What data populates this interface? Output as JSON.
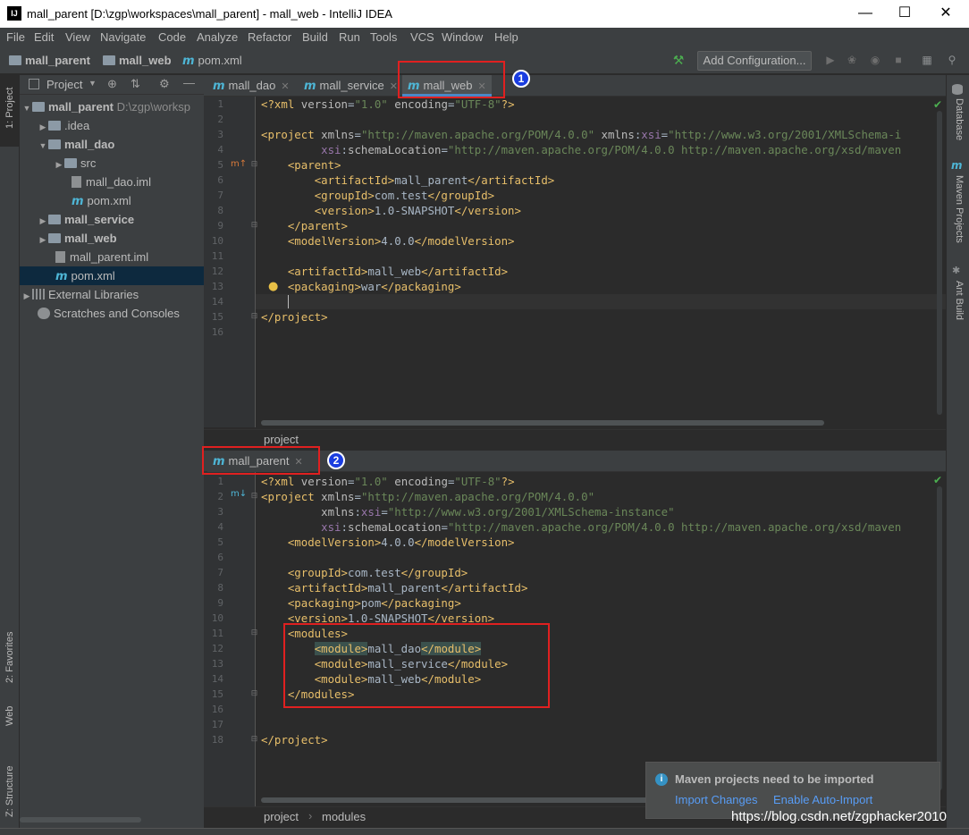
{
  "window": {
    "title": "mall_parent [D:\\zgp\\workspaces\\mall_parent] - mall_web - IntelliJ IDEA",
    "app_icon": "IJ"
  },
  "menu": [
    "File",
    "Edit",
    "View",
    "Navigate",
    "Code",
    "Analyze",
    "Refactor",
    "Build",
    "Run",
    "Tools",
    "VCS",
    "Window",
    "Help"
  ],
  "breadcrumb": {
    "root": "mall_parent",
    "module": "mall_web",
    "file": "pom.xml"
  },
  "toolbar": {
    "add_configuration": "Add Configuration..."
  },
  "left_strip": {
    "project": "1: Project",
    "favorites": "2: Favorites",
    "web": "Web",
    "structure": "Z: Structure"
  },
  "right_strip": {
    "database": "Database",
    "maven": "Maven Projects",
    "ant": "Ant Build"
  },
  "project_panel": {
    "header": "Project",
    "root_name": "mall_parent",
    "root_path": "D:\\zgp\\worksp",
    "idea": ".idea",
    "mall_dao": "mall_dao",
    "src": "src",
    "mall_dao_iml": "mall_dao.iml",
    "dao_pom": "pom.xml",
    "mall_service": "mall_service",
    "mall_web": "mall_web",
    "mall_parent_iml": "mall_parent.iml",
    "root_pom": "pom.xml",
    "external_libraries": "External Libraries",
    "scratches": "Scratches and Consoles"
  },
  "top_editor": {
    "tabs": [
      "mall_dao",
      "mall_service",
      "mall_web"
    ],
    "active_tab": "mall_web",
    "breadcrumb": "project"
  },
  "bottom_editor": {
    "tab": "mall_parent",
    "breadcrumb": [
      "project",
      "modules"
    ]
  },
  "annotations": {
    "badge1": "1",
    "badge2": "2"
  },
  "notification": {
    "title": "Maven projects need to be imported",
    "import_changes": "Import Changes",
    "enable_auto_import": "Enable Auto-Import"
  },
  "watermark": "https://blog.csdn.net/zgphacker2010",
  "colors": {
    "accent": "#4a88c7",
    "annotation_red": "#e02020",
    "badge_blue": "#1a3de0"
  }
}
